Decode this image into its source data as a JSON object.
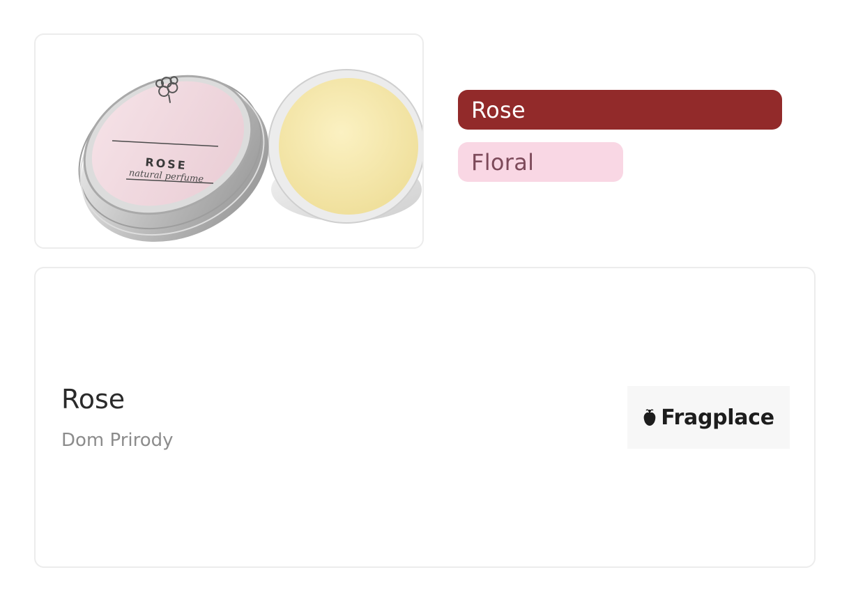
{
  "product_image": {
    "lid_title": "ROSE",
    "lid_subtitle": "natural perfume",
    "icon": "tree-icon"
  },
  "tags": {
    "primary": "Rose",
    "secondary": "Floral"
  },
  "product": {
    "name": "Rose",
    "brand": "Dom Prirody"
  },
  "vendor": {
    "name": "Fragplace",
    "icon": "fragplace-logo-icon"
  },
  "colors": {
    "primary_tag": "#922a2a",
    "secondary_tag": "#f9d7e4",
    "secondary_tag_text": "#7d4a5a"
  }
}
